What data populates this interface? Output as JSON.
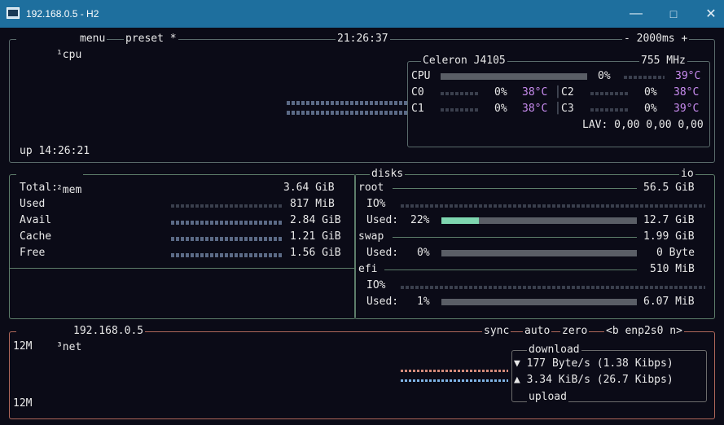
{
  "window": {
    "title": "192.168.0.5 - H2",
    "minimize": "—",
    "maximize": "□",
    "close": "✕"
  },
  "cpu": {
    "label_num": "¹",
    "label": "cpu",
    "menu": "menu",
    "preset": "preset *",
    "clock": "21:26:37",
    "interval": "- 2000ms +",
    "uptime": "up 14:26:21",
    "model": "Celeron J4105",
    "freq": "755 MHz",
    "total": {
      "name": "CPU",
      "pct": "0%",
      "temp": "39°C"
    },
    "cores": [
      {
        "name": "C0",
        "pct": "0%",
        "temp": "38°C"
      },
      {
        "name": "C2",
        "pct": "0%",
        "temp": "38°C"
      },
      {
        "name": "C1",
        "pct": "0%",
        "temp": "38°C"
      },
      {
        "name": "C3",
        "pct": "0%",
        "temp": "39°C"
      }
    ],
    "lav": "LAV: 0,00 0,00 0,00"
  },
  "mem": {
    "label_num": "²",
    "label": "mem",
    "rows": [
      {
        "name": "Total:",
        "value": "3.64 GiB"
      },
      {
        "name": "Used",
        "value": "817 MiB"
      },
      {
        "name": "Avail",
        "value": "2.84 GiB"
      },
      {
        "name": "Cache",
        "value": "1.21 GiB"
      },
      {
        "name": "Free",
        "value": "1.56 GiB"
      }
    ]
  },
  "disks": {
    "label": "disks",
    "io_label": "io",
    "items": [
      {
        "name": "root",
        "size": "56.5 GiB",
        "io": "IO%",
        "used_label": "Used:",
        "used_pct": "22%",
        "used_fraction": 0.22,
        "used_value": "12.7 GiB"
      },
      {
        "name": "swap",
        "size": "1.99 GiB",
        "used_label": "Used:",
        "used_pct": "0%",
        "used_fraction": 0,
        "used_value": "0 Byte"
      },
      {
        "name": "efi",
        "size": "510 MiB",
        "io": "IO%",
        "used_label": "Used:",
        "used_pct": "1%",
        "used_fraction": 0.01,
        "used_value": "6.07 MiB"
      }
    ]
  },
  "net": {
    "label_num": "³",
    "label": "net",
    "address": "192.168.0.5",
    "sync": "sync",
    "auto": "auto",
    "zero": "zero",
    "iface": "<b enp2s0 n>",
    "scale_top": "12M",
    "scale_bottom": "12M",
    "download_label": "download",
    "upload_label": "upload",
    "download": "▼ 177 Byte/s (1.38 Kibps)",
    "upload": "▲ 3.34 KiB/s (26.7 Kibps)"
  },
  "colors": {
    "titlebar": "#1e6f9e",
    "accent_mem": "#7fd6b0",
    "temp": "#c98cf0",
    "net_border": "#b0685a"
  }
}
